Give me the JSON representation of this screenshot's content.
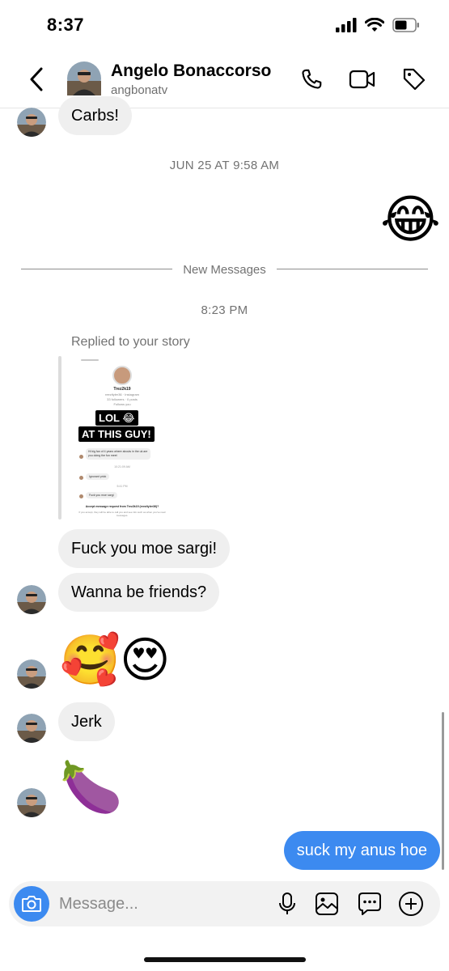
{
  "status_bar": {
    "time": "8:37"
  },
  "header": {
    "contact_name": "Angelo Bonaccorso",
    "contact_handle": "angbonatv",
    "icons": [
      "chevron-left-icon",
      "phone-icon",
      "video-camera-icon",
      "tag-icon"
    ]
  },
  "thread": {
    "carbs_message": "Carbs!",
    "timestamp_1": "JUN 25 AT 9:58 AM",
    "sent_emoji": "😂",
    "new_messages_label": "New Messages",
    "timestamp_2": "8:23 PM",
    "replied_label": "Replied to your story",
    "story_preview": {
      "username": "Trez2k19",
      "sub_1": "reezltyler36 · Instagram",
      "sub_2": "33 followers · 0 posts",
      "sub_3": "Follows you",
      "caption_line_1": "LOL 😂",
      "caption_line_2": "AT THIS GUY!",
      "msg_1": "Hi big fan of 4 years where abouts in the uk are you doing the fun meet",
      "time_1": "10:21:09 AM",
      "msg_2": "Ignorant prick",
      "time_2": "5:41 PM",
      "msg_3": "Fuck you moe sargi",
      "accept_text": "Accept message request from Trez2k19 (reezltyler36)?",
      "accept_sub": "If you accept, they will be able to call you and see info such as when you've read messages."
    },
    "message_fuck": "Fuck you moe sargi!",
    "message_friends": "Wanna be friends?",
    "emoji_hearts": "🥰",
    "emoji_heart_eyes": "😍",
    "message_jerk": "Jerk",
    "emoji_eggplant": "🍆",
    "sent_message": "suck my anus hoe"
  },
  "composer": {
    "placeholder": "Message...",
    "icons": [
      "camera-icon",
      "microphone-icon",
      "gallery-icon",
      "sticker-icon",
      "plus-icon"
    ]
  },
  "colors": {
    "accent_blue": "#3c8af0",
    "bubble_gray": "#efefef",
    "meta_gray": "#727272"
  }
}
